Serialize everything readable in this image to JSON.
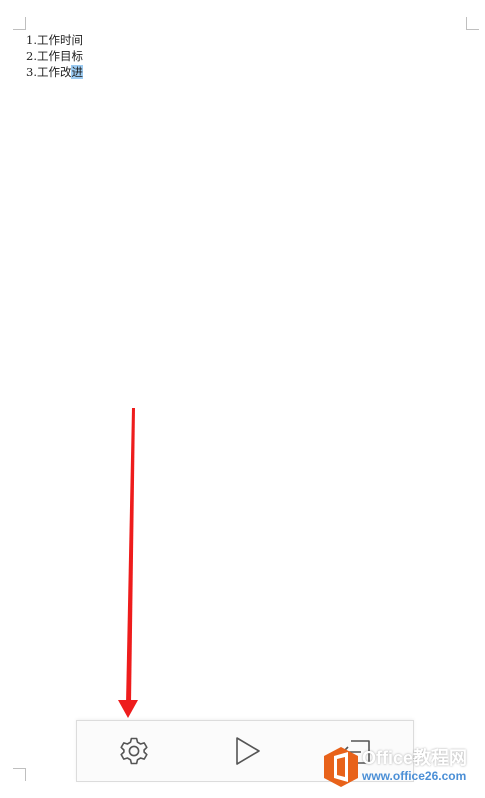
{
  "document": {
    "lines": [
      {
        "text": "1.工作时间"
      },
      {
        "text": "2.工作目标"
      },
      {
        "text": "3.工作改",
        "selected": "进"
      }
    ]
  },
  "toolbar": {
    "buttons": [
      {
        "name": "settings",
        "icon": "gear-icon"
      },
      {
        "name": "play",
        "icon": "play-icon"
      },
      {
        "name": "exit",
        "icon": "exit-icon"
      }
    ]
  },
  "annotation": {
    "color": "#ee1c1c",
    "icon": "red-arrow-icon"
  },
  "watermark": {
    "title": "Office教程网",
    "url": "www.office26.com",
    "brand_color": "#e8621a"
  }
}
